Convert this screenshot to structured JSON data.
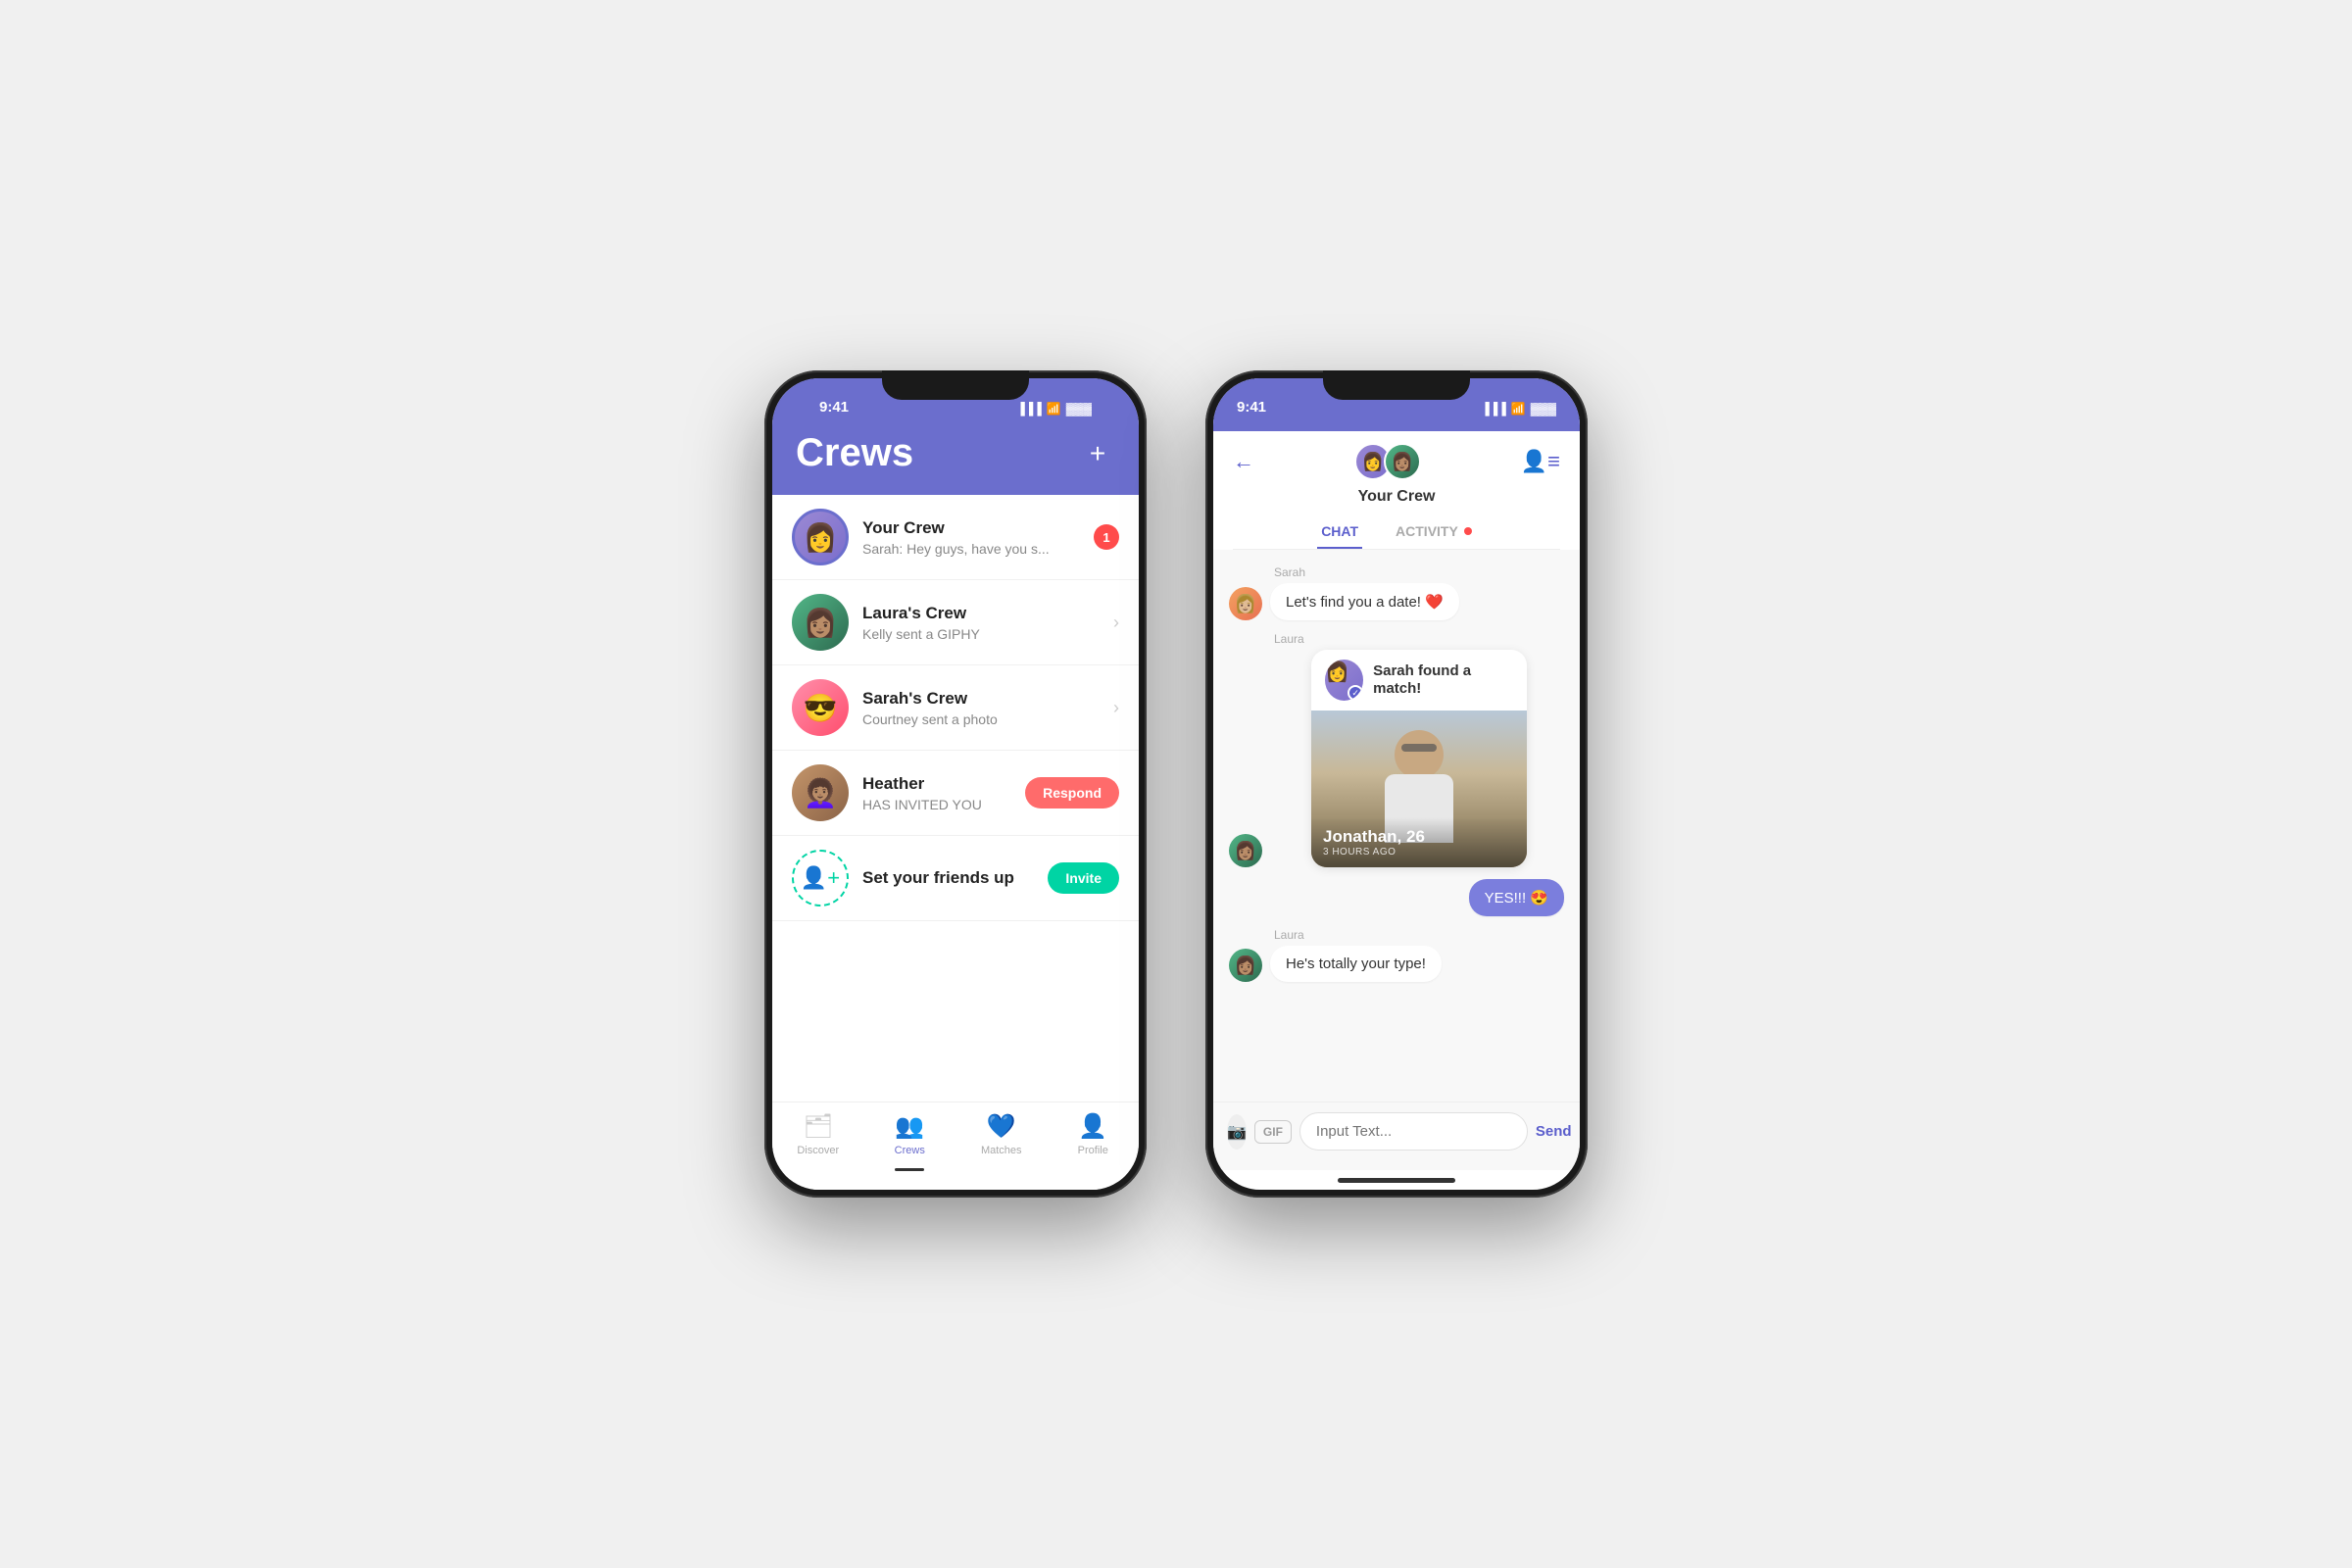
{
  "phone1": {
    "status_time": "9:41",
    "header_title": "Crews",
    "add_btn": "+",
    "crews": [
      {
        "name": "Your Crew",
        "preview": "Sarah: Hey guys, have you s...",
        "badge": "1",
        "type": "your_crew"
      },
      {
        "name": "Laura's Crew",
        "preview": "Kelly sent a GIPHY",
        "badge": null,
        "type": "normal"
      },
      {
        "name": "Sarah's Crew",
        "preview": "Courtney sent a photo",
        "badge": null,
        "type": "normal"
      },
      {
        "name": "Heather",
        "preview": "HAS INVITED YOU",
        "badge": null,
        "type": "respond"
      }
    ],
    "invite_label": "Set your friends up",
    "invite_btn": "Invite",
    "respond_btn": "Respond",
    "nav": {
      "discover": "Discover",
      "crews": "Crews",
      "matches": "Matches",
      "profile": "Profile"
    }
  },
  "phone2": {
    "status_time": "9:41",
    "back_label": "←",
    "crew_name": "Your Crew",
    "tab_chat": "CHAT",
    "tab_activity": "ACTIVITY",
    "messages": [
      {
        "sender": "Sarah",
        "text": "Let's find you a date! ❤️",
        "side": "left"
      },
      {
        "sender": "Laura",
        "type": "match_card",
        "found_text": "Sarah found a match!",
        "match_name": "Jonathan, 26",
        "match_time": "3 HOURS AGO"
      },
      {
        "sender": "me",
        "text": "YES!!! 😍",
        "side": "right"
      },
      {
        "sender": "Laura",
        "text": "He's totally your type!",
        "side": "left"
      }
    ],
    "input_placeholder": "Input Text...",
    "send_label": "Send",
    "gif_label": "GIF"
  }
}
